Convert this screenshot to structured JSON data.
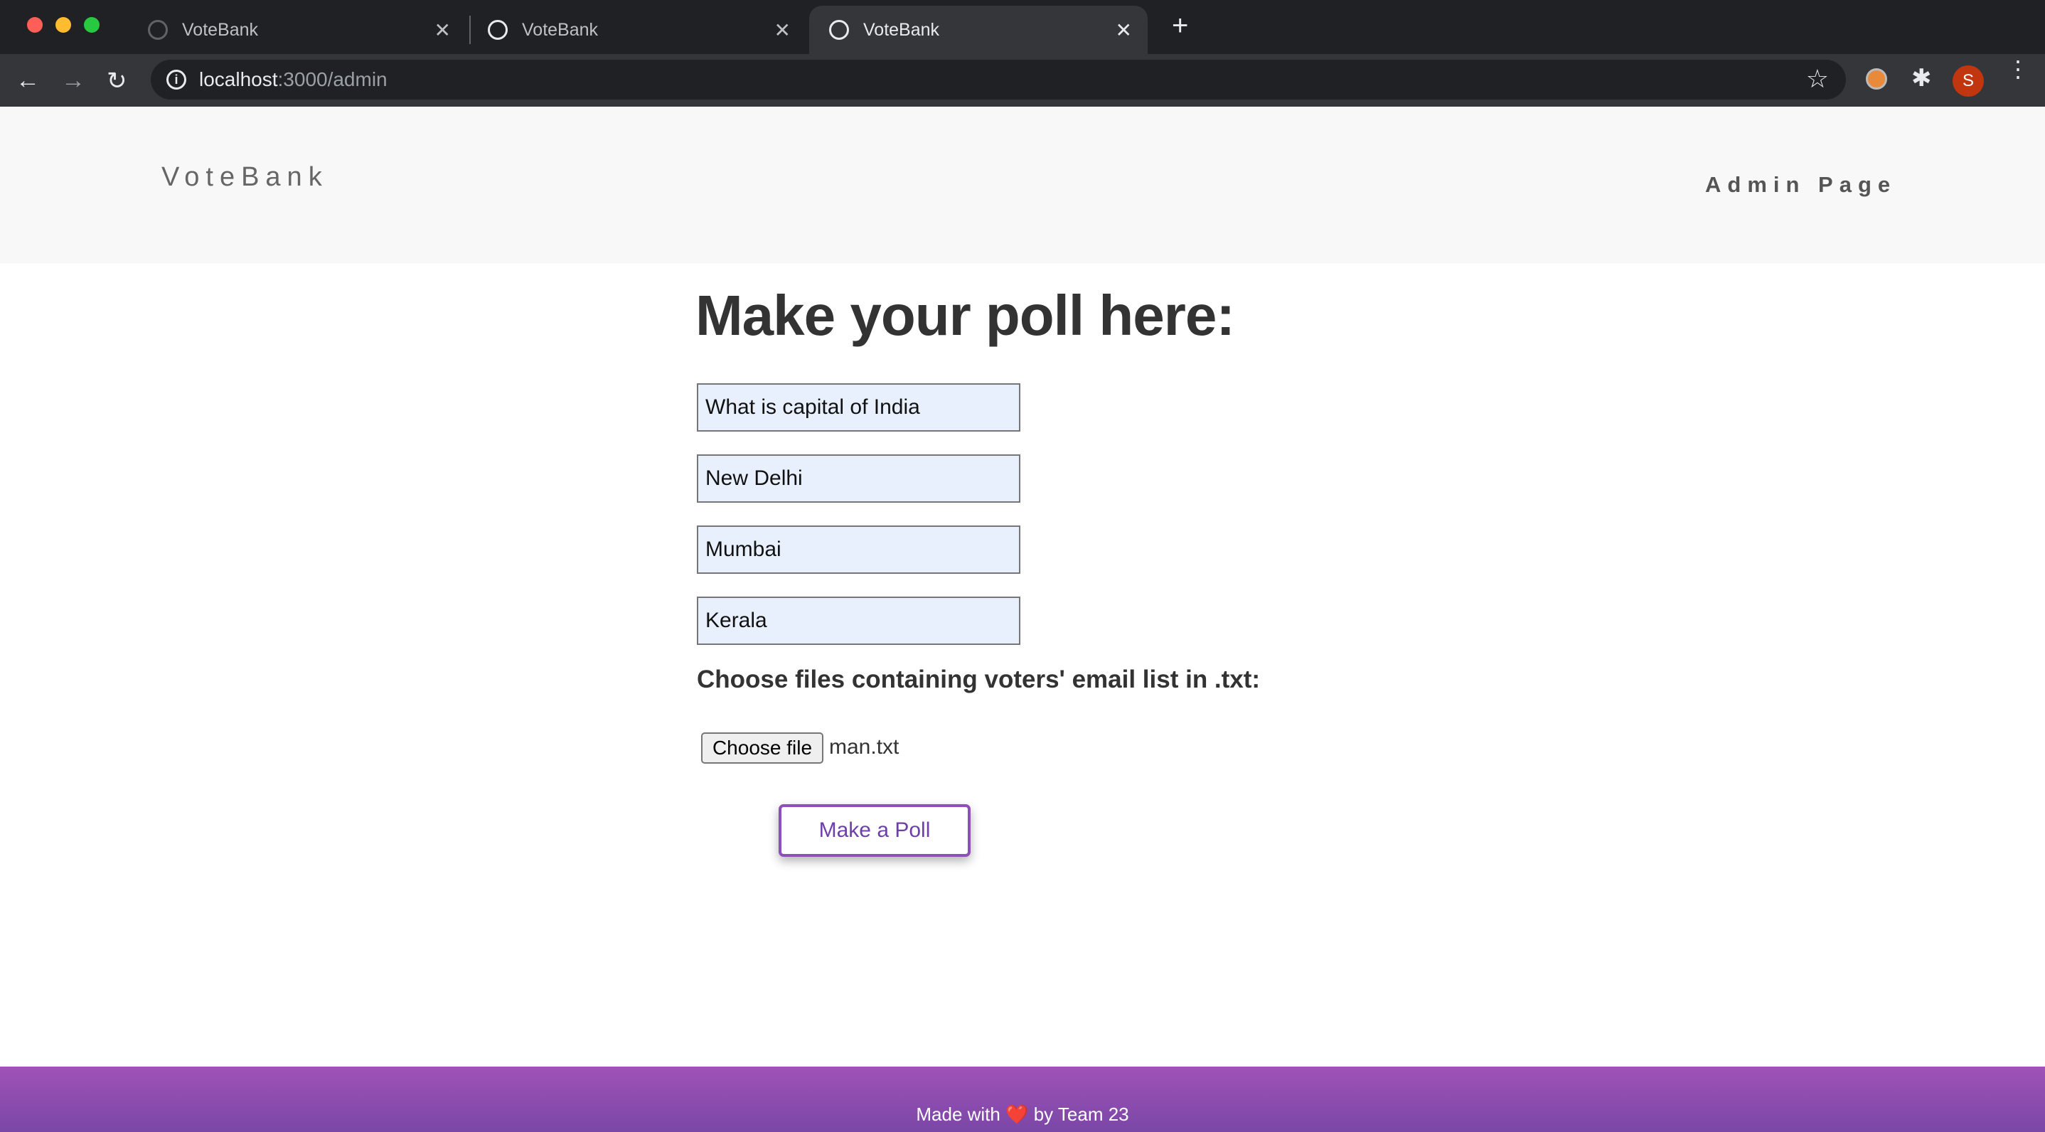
{
  "browser": {
    "tabs": [
      {
        "title": "VoteBank"
      },
      {
        "title": "VoteBank"
      },
      {
        "title": "VoteBank",
        "active": true
      }
    ],
    "url_host": "localhost",
    "url_path": ":3000/admin",
    "profile_initial": "S"
  },
  "header": {
    "logo": "VoteBank",
    "admin_link": "Admin Page"
  },
  "main": {
    "title": "Make your poll here:",
    "question": "What is capital of India",
    "options": [
      "New Delhi",
      "Mumbai",
      "Kerala"
    ],
    "file_label": "Choose files containing voters' email list in .txt:",
    "file_button": "Choose file",
    "file_name": "man.txt",
    "submit": "Make a Poll"
  },
  "footer": {
    "text_before": "Made with",
    "heart": "❤️",
    "text_after": "by Team 23"
  },
  "colors": {
    "accent": "#8e4fb8",
    "footer_top": "#a052b8",
    "footer_bottom": "#7a47a6"
  }
}
